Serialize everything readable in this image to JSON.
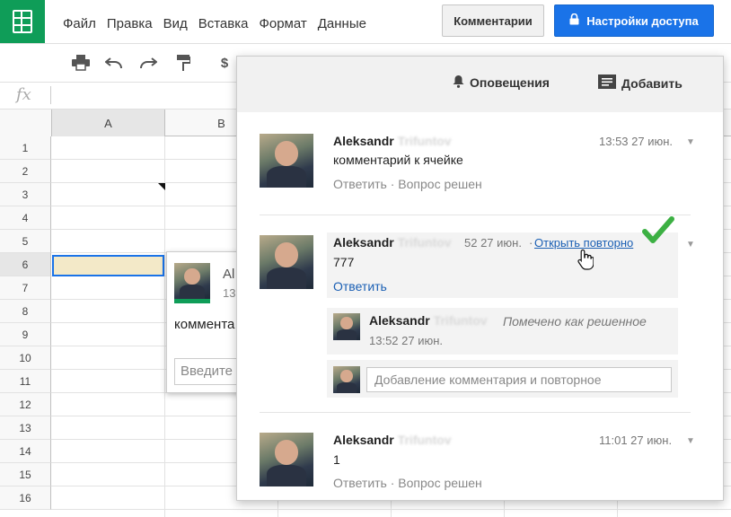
{
  "menu": [
    "Файл",
    "Правка",
    "Вид",
    "Вставка",
    "Формат",
    "Данные"
  ],
  "buttons": {
    "comments": "Комментарии",
    "share": "Настройки доступа"
  },
  "toolbar": {
    "currency": "$"
  },
  "formula": {
    "fx": "fx"
  },
  "columns": [
    "A",
    "B"
  ],
  "rows": [
    "1",
    "2",
    "3",
    "4",
    "5",
    "6",
    "7",
    "8",
    "9",
    "10",
    "11",
    "12",
    "13",
    "14",
    "15",
    "16"
  ],
  "popup": {
    "author_fragment": "Al",
    "time_fragment": "13",
    "text_fragment": "коммента",
    "input_fragment": "Введите"
  },
  "panel": {
    "notifications": "Оповещения",
    "add": "Добавить",
    "comments": [
      {
        "author": "Aleksandr",
        "author_blur": "Trifuntov",
        "time": "13:53 27 июн.",
        "text": "комментарий к ячейке",
        "reply": "Ответить",
        "resolve": "Вопрос решен"
      },
      {
        "author": "Aleksandr",
        "author_blur": "Trifuntov",
        "time": "52 27 июн.",
        "reopen": "Открыть повторно",
        "text": "777",
        "reply": "Ответить"
      },
      {
        "author": "Aleksandr",
        "author_blur": "Trifuntov",
        "time": "11:01 27 июн.",
        "text": "1",
        "reply": "Ответить",
        "resolve": "Вопрос решен"
      }
    ],
    "sub": {
      "author": "Aleksandr",
      "author_blur": "Trifuntov",
      "status": "Помечено как решенное",
      "time": "13:52 27 июн."
    },
    "reply_placeholder": "Добавление комментария и повторное"
  },
  "colors": {
    "accent": "#1a73e8",
    "brand": "#0f9d58",
    "selected_cell": "#f3e9c8",
    "check": "#3cb043"
  }
}
